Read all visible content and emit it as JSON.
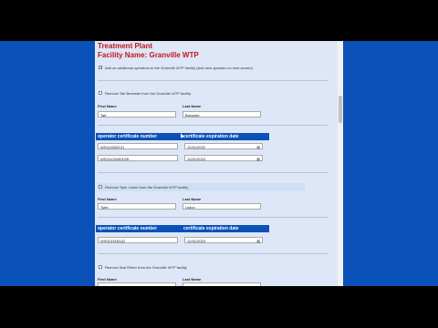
{
  "header": {
    "title": "Treatment Plant",
    "facility": "Facility Name: Granville WTP"
  },
  "add_operators": {
    "checked": true,
    "label": "Add an additional operators to the Granville WTP facility (Add new operator on next screen)"
  },
  "operators": [
    {
      "remove_label": "Remove Tab Brewster from the Granville WTP facility",
      "first_name_label": "First Name",
      "last_name_label": "Last Name",
      "first_name": "Tab",
      "last_name": "Brewster",
      "cert_header": "operator certificate number",
      "exp_header": "certificate expiration date",
      "certs": [
        {
          "number": "WS110345131",
          "expiration": "12/31/2022"
        },
        {
          "number": "WS111034501SB",
          "expiration": "12/31/2023"
        }
      ]
    },
    {
      "remove_label": "Remove Tyler Liston from the Granville WTP facility",
      "first_name_label": "First Name",
      "last_name_label": "Last Name",
      "first_name": "Tyler",
      "last_name": "Liston",
      "cert_header": "operator certificate number",
      "exp_header": "certificate expiration date",
      "certs": [
        {
          "number": "WS0103451Q2",
          "expiration": "12/31/2023"
        }
      ]
    },
    {
      "remove_label": "Remove Bob Reiter from the Granville WTP facility",
      "first_name_label": "First Name",
      "last_name_label": "Last Name"
    }
  ],
  "icons": {
    "calendar": "calendar-icon",
    "cursor": "mouse-cursor-icon"
  },
  "colors": {
    "page_bg": "#0a51b8",
    "form_bg": "#dde7f7",
    "title_red": "#c4161c",
    "header_blue": "#0a51b8"
  }
}
